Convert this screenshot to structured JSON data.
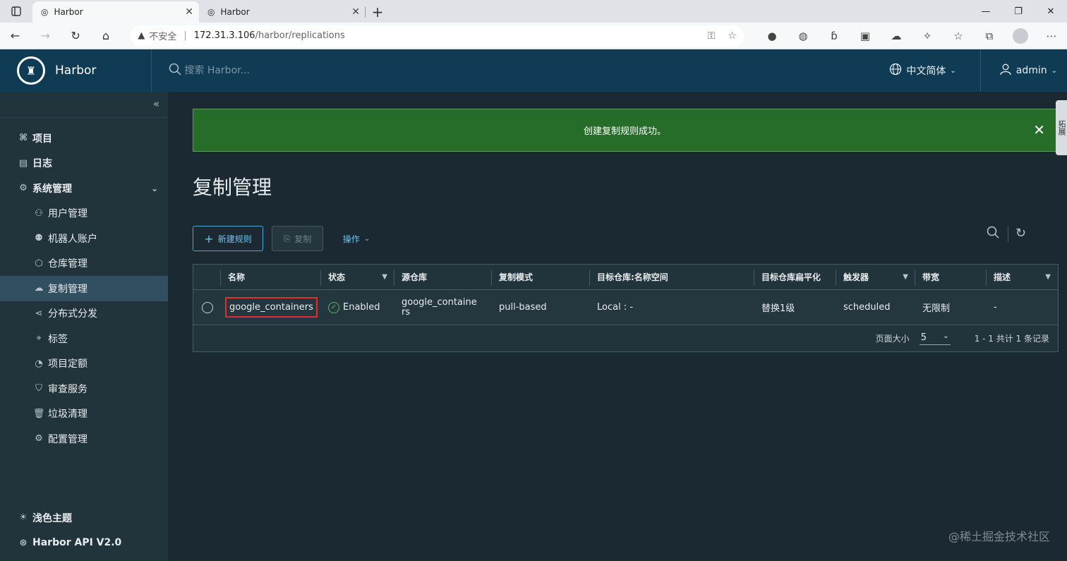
{
  "browser": {
    "tabs": [
      {
        "title": "Harbor",
        "active": true
      },
      {
        "title": "Harbor",
        "active": false
      }
    ],
    "address": {
      "security_label": "不安全",
      "host": "172.31.3.106",
      "path": "/harbor/replications"
    }
  },
  "header": {
    "brand": "Harbor",
    "search_placeholder": "搜索 Harbor...",
    "language": "中文简体",
    "user": "admin"
  },
  "sidebar": {
    "items": [
      {
        "label": "项目",
        "icon": "projects-icon",
        "level": "top"
      },
      {
        "label": "日志",
        "icon": "logs-icon",
        "level": "top"
      },
      {
        "label": "系统管理",
        "icon": "admin-icon",
        "level": "top"
      },
      {
        "label": "用户管理",
        "icon": "users-icon",
        "level": "sub"
      },
      {
        "label": "机器人账户",
        "icon": "robot-icon",
        "level": "sub"
      },
      {
        "label": "仓库管理",
        "icon": "registry-icon",
        "level": "sub"
      },
      {
        "label": "复制管理",
        "icon": "cloud-icon",
        "level": "sub",
        "active": true
      },
      {
        "label": "分布式分发",
        "icon": "share-icon",
        "level": "sub"
      },
      {
        "label": "标签",
        "icon": "tag-icon",
        "level": "sub"
      },
      {
        "label": "项目定额",
        "icon": "quota-icon",
        "level": "sub"
      },
      {
        "label": "审查服务",
        "icon": "shield-icon",
        "level": "sub"
      },
      {
        "label": "垃圾清理",
        "icon": "trash-icon",
        "level": "sub"
      },
      {
        "label": "配置管理",
        "icon": "gear-icon",
        "level": "sub"
      }
    ],
    "bottom": [
      {
        "label": "浅色主题",
        "icon": "sun-icon"
      },
      {
        "label": "Harbor API V2.0",
        "icon": "api-icon"
      }
    ]
  },
  "main": {
    "alert": "创建复制规则成功。",
    "side_tab": "拓展",
    "title": "复制管理",
    "toolbar": {
      "new_rule": "新建规则",
      "copy": "复制",
      "actions": "操作"
    },
    "table": {
      "columns": [
        "名称",
        "状态",
        "源仓库",
        "复制模式",
        "目标仓库:名称空间",
        "目标仓库扁平化",
        "触发器",
        "带宽",
        "描述"
      ],
      "rows": [
        {
          "name": "google_containers",
          "status": "Enabled",
          "source": "google_containers",
          "mode": "pull-based",
          "dest": "Local : -",
          "flatten": "替换1级",
          "trigger": "scheduled",
          "bandwidth": "无限制",
          "description": "-"
        }
      ],
      "footer": {
        "page_size_label": "页面大小",
        "page_size": "5",
        "summary": "1 - 1 共计 1 条记录"
      }
    }
  },
  "watermark": "@稀土掘金技术社区",
  "colors": {
    "header": "#0f3b54",
    "sidebar": "#21333b",
    "content": "#1b2a32",
    "success": "#266d2a",
    "accent": "#4aa8d8",
    "highlight_border": "#e0302d"
  }
}
